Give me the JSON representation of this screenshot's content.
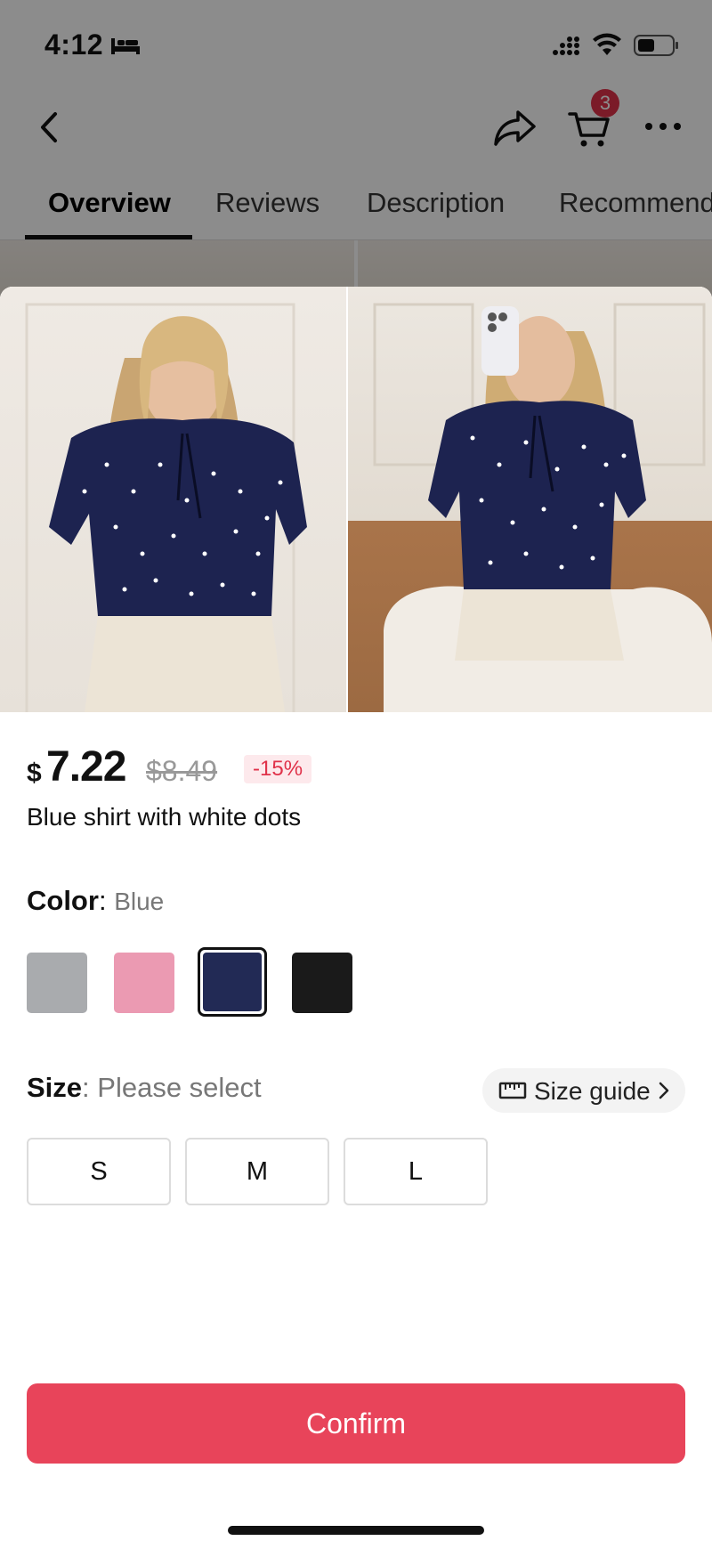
{
  "status_bar": {
    "time": "4:12"
  },
  "cart": {
    "badge_count": "3"
  },
  "tabs": [
    {
      "label": "Overview",
      "active": true
    },
    {
      "label": "Reviews"
    },
    {
      "label": "Description"
    },
    {
      "label": "Recommend"
    }
  ],
  "product": {
    "currency_symbol": "$",
    "price": "7.22",
    "original_price": "$8.49",
    "discount": "-15%",
    "title": "Blue shirt with white dots"
  },
  "color": {
    "label": "Color",
    "separator": ":",
    "selected_value": "Blue",
    "swatches": [
      {
        "name": "Gray",
        "hex": "#a9abae"
      },
      {
        "name": "Pink",
        "hex": "#eb9ab2"
      },
      {
        "name": "Blue",
        "hex": "#222a55",
        "selected": true
      },
      {
        "name": "Black",
        "hex": "#1a1a1a"
      }
    ]
  },
  "size": {
    "label": "Size",
    "separator": ":",
    "placeholder": "Please select",
    "guide_label": "Size guide",
    "options": [
      "S",
      "M",
      "L"
    ]
  },
  "confirm_label": "Confirm",
  "colors": {
    "accent": "#e8445a",
    "badge": "#e0324a",
    "discount_bg": "#fde9ec"
  }
}
